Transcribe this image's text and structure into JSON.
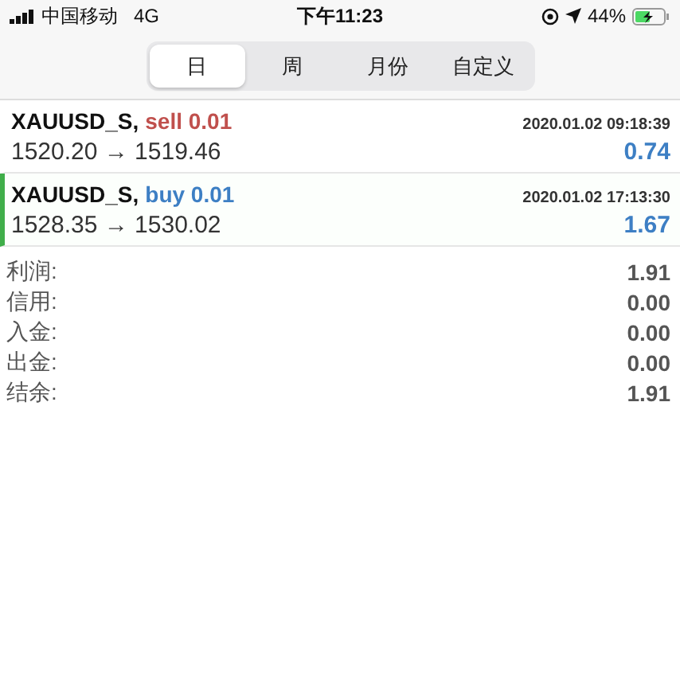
{
  "status_bar": {
    "carrier": "中国移动",
    "network": "4G",
    "time": "下午11:23",
    "battery": "44%"
  },
  "tabs": [
    {
      "label": "日",
      "selected": true
    },
    {
      "label": "周",
      "selected": false
    },
    {
      "label": "月份",
      "selected": false
    },
    {
      "label": "自定义",
      "selected": false
    }
  ],
  "trades": [
    {
      "symbol": "XAUUSD_S,",
      "kind": "sell",
      "side_text": "sell 0.01",
      "time": "2020.01.02 09:18:39",
      "prices": "1520.20 → 1519.46",
      "profit": "0.74",
      "selected": false
    },
    {
      "symbol": "XAUUSD_S,",
      "kind": "buy",
      "side_text": "buy 0.01",
      "time": "2020.01.02 17:13:30",
      "prices": "1528.35 → 1530.02",
      "profit": "1.67",
      "selected": true
    }
  ],
  "summary": [
    {
      "label": "利润:",
      "value": "1.91"
    },
    {
      "label": "信用:",
      "value": "0.00"
    },
    {
      "label": "入金:",
      "value": "0.00"
    },
    {
      "label": "出金:",
      "value": "0.00"
    },
    {
      "label": "结余:",
      "value": "1.91"
    }
  ]
}
